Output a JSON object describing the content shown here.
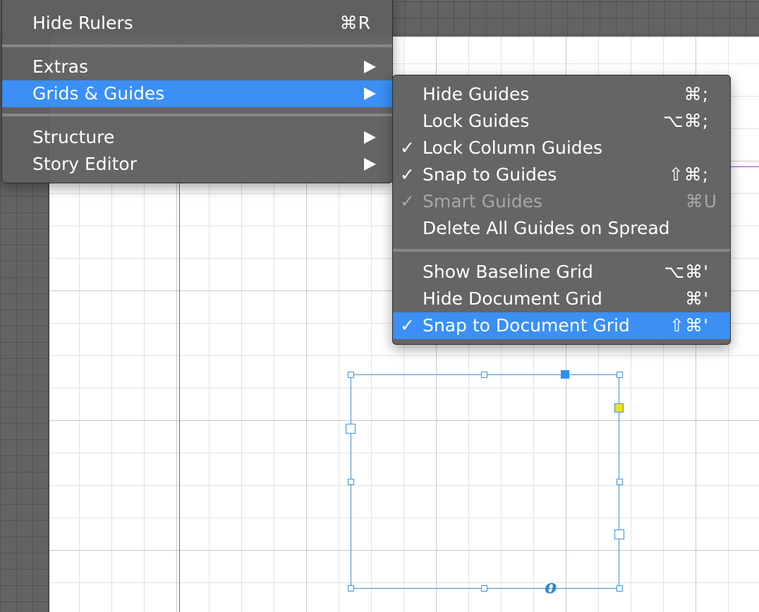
{
  "main_menu": {
    "items": [
      {
        "label": "Hide Rulers",
        "shortcut": "⌘R"
      },
      {
        "label": "Extras"
      },
      {
        "label": "Grids & Guides"
      },
      {
        "label": "Structure"
      },
      {
        "label": "Story Editor"
      }
    ]
  },
  "submenu": {
    "items": [
      {
        "label": "Hide Guides",
        "shortcut": "⌘;"
      },
      {
        "label": "Lock Guides",
        "shortcut": "⌥⌘;"
      },
      {
        "label": "Lock Column Guides",
        "check": "✓"
      },
      {
        "label": "Snap to Guides",
        "check": "✓",
        "shortcut": "⇧⌘;"
      },
      {
        "label": "Smart Guides",
        "check": "✓",
        "shortcut": "⌘U"
      },
      {
        "label": "Delete All Guides on Spread"
      },
      {
        "label": "Show Baseline Grid",
        "shortcut": "⌥⌘'"
      },
      {
        "label": "Hide Document Grid",
        "shortcut": "⌘'"
      },
      {
        "label": "Snap to Document Grid",
        "check": "✓",
        "shortcut": "⇧⌘'"
      }
    ]
  },
  "frame": {
    "mark": "o"
  },
  "colors": {
    "menu_bg": "#606060",
    "highlight": "#3b8ff5",
    "guide": "#a43bd7",
    "selection": "#3d94d8",
    "disabled_text": "#a7a7a7"
  },
  "icons": [
    "checkmark-icon",
    "submenu-arrow-icon",
    "command-key-glyph",
    "option-key-glyph",
    "shift-key-glyph"
  ]
}
